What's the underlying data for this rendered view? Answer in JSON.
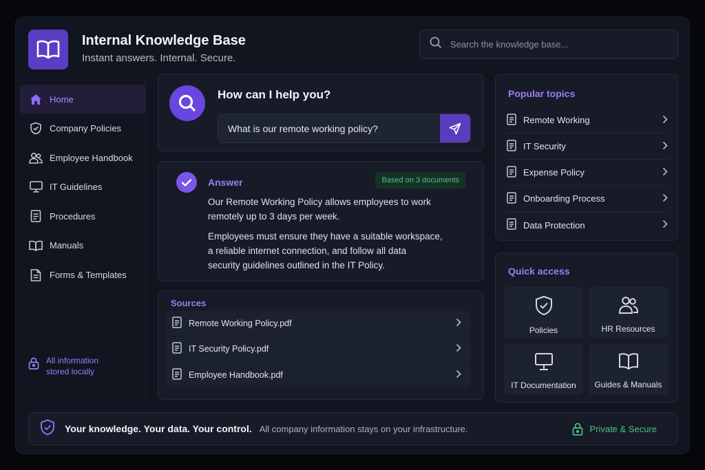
{
  "header": {
    "title": "Internal Knowledge Base",
    "subtitle": "Instant answers. Internal. Secure.",
    "logo_icon": "book-icon"
  },
  "search": {
    "placeholder": "Search the knowledge base..."
  },
  "sidebar": {
    "items": [
      {
        "label": "Home",
        "icon": "home-icon",
        "active": true
      },
      {
        "label": "Company Policies",
        "icon": "shield-icon"
      },
      {
        "label": "Employee Handbook",
        "icon": "users-icon"
      },
      {
        "label": "IT Guidelines",
        "icon": "monitor-icon"
      },
      {
        "label": "Procedures",
        "icon": "document-icon"
      },
      {
        "label": "Manuals",
        "icon": "book-icon"
      },
      {
        "label": "Forms & Templates",
        "icon": "form-icon"
      }
    ],
    "footer_line1": "All information",
    "footer_line2": "stored locally"
  },
  "ask": {
    "title": "How can I help you?",
    "query": "What is our remote working policy?"
  },
  "answer": {
    "title": "Answer",
    "badge": "Based on 3 documents",
    "p1_line1": "Our Remote Working Policy allows employees to work",
    "p1_line2": "remotely up to 3 days per week.",
    "p2_line1": "Employees must ensure they have a suitable workspace,",
    "p2_line2": "a reliable internet connection, and follow all data",
    "p2_line3": "security guidelines outlined in the IT Policy."
  },
  "sources": {
    "title": "Sources",
    "items": [
      {
        "label": "Remote Working Policy.pdf"
      },
      {
        "label": "IT Security Policy.pdf"
      },
      {
        "label": "Employee Handbook.pdf"
      }
    ]
  },
  "popular": {
    "title": "Popular topics",
    "items": [
      {
        "label": "Remote Working"
      },
      {
        "label": "IT Security"
      },
      {
        "label": "Expense Policy"
      },
      {
        "label": "Onboarding Process"
      },
      {
        "label": "Data Protection"
      }
    ]
  },
  "quick": {
    "title": "Quick access",
    "items": [
      {
        "label": "Policies",
        "icon": "shield-check-icon"
      },
      {
        "label": "HR Resources",
        "icon": "users-icon"
      },
      {
        "label": "IT Documentation",
        "icon": "monitor-icon"
      },
      {
        "label": "Guides & Manuals",
        "icon": "book-icon"
      }
    ]
  },
  "footer": {
    "bold": "Your knowledge. Your data. Your control.",
    "text": "All company information stays on your infrastructure.",
    "secure": "Private & Secure"
  },
  "colors": {
    "accent": "#7a55ea",
    "accent_text": "#9d7df5",
    "success": "#4fc27f",
    "background": "#111520",
    "panel": "#161b27"
  }
}
